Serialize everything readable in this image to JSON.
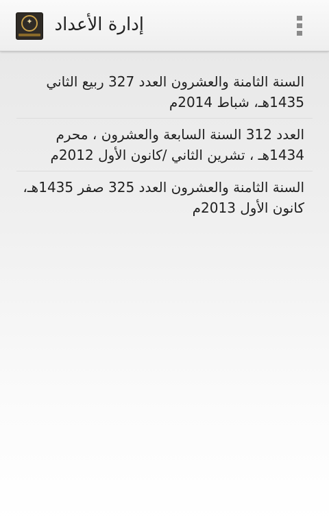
{
  "header": {
    "title": "إدارة الأعداد",
    "app_icon": "magazine-logo-icon",
    "menu_icon": "overflow-menu-icon"
  },
  "issues": [
    {
      "label": "السنة الثامنة والعشرون العدد 327 ربيع الثاني 1435هـ، شباط 2014م"
    },
    {
      "label": "العدد 312 السنة السابعة والعشرون ، محرم 1434هـ ، تشرين الثاني /كانون الأول 2012م"
    },
    {
      "label": "السنة الثامنة والعشرون العدد 325 صفر 1435هـ، كانون الأول 2013م"
    }
  ],
  "colors": {
    "action_bar": "#f2f2f2",
    "text": "#1f1f1f",
    "divider": "#dcdcdc",
    "icon_gold": "#c9a14a"
  }
}
